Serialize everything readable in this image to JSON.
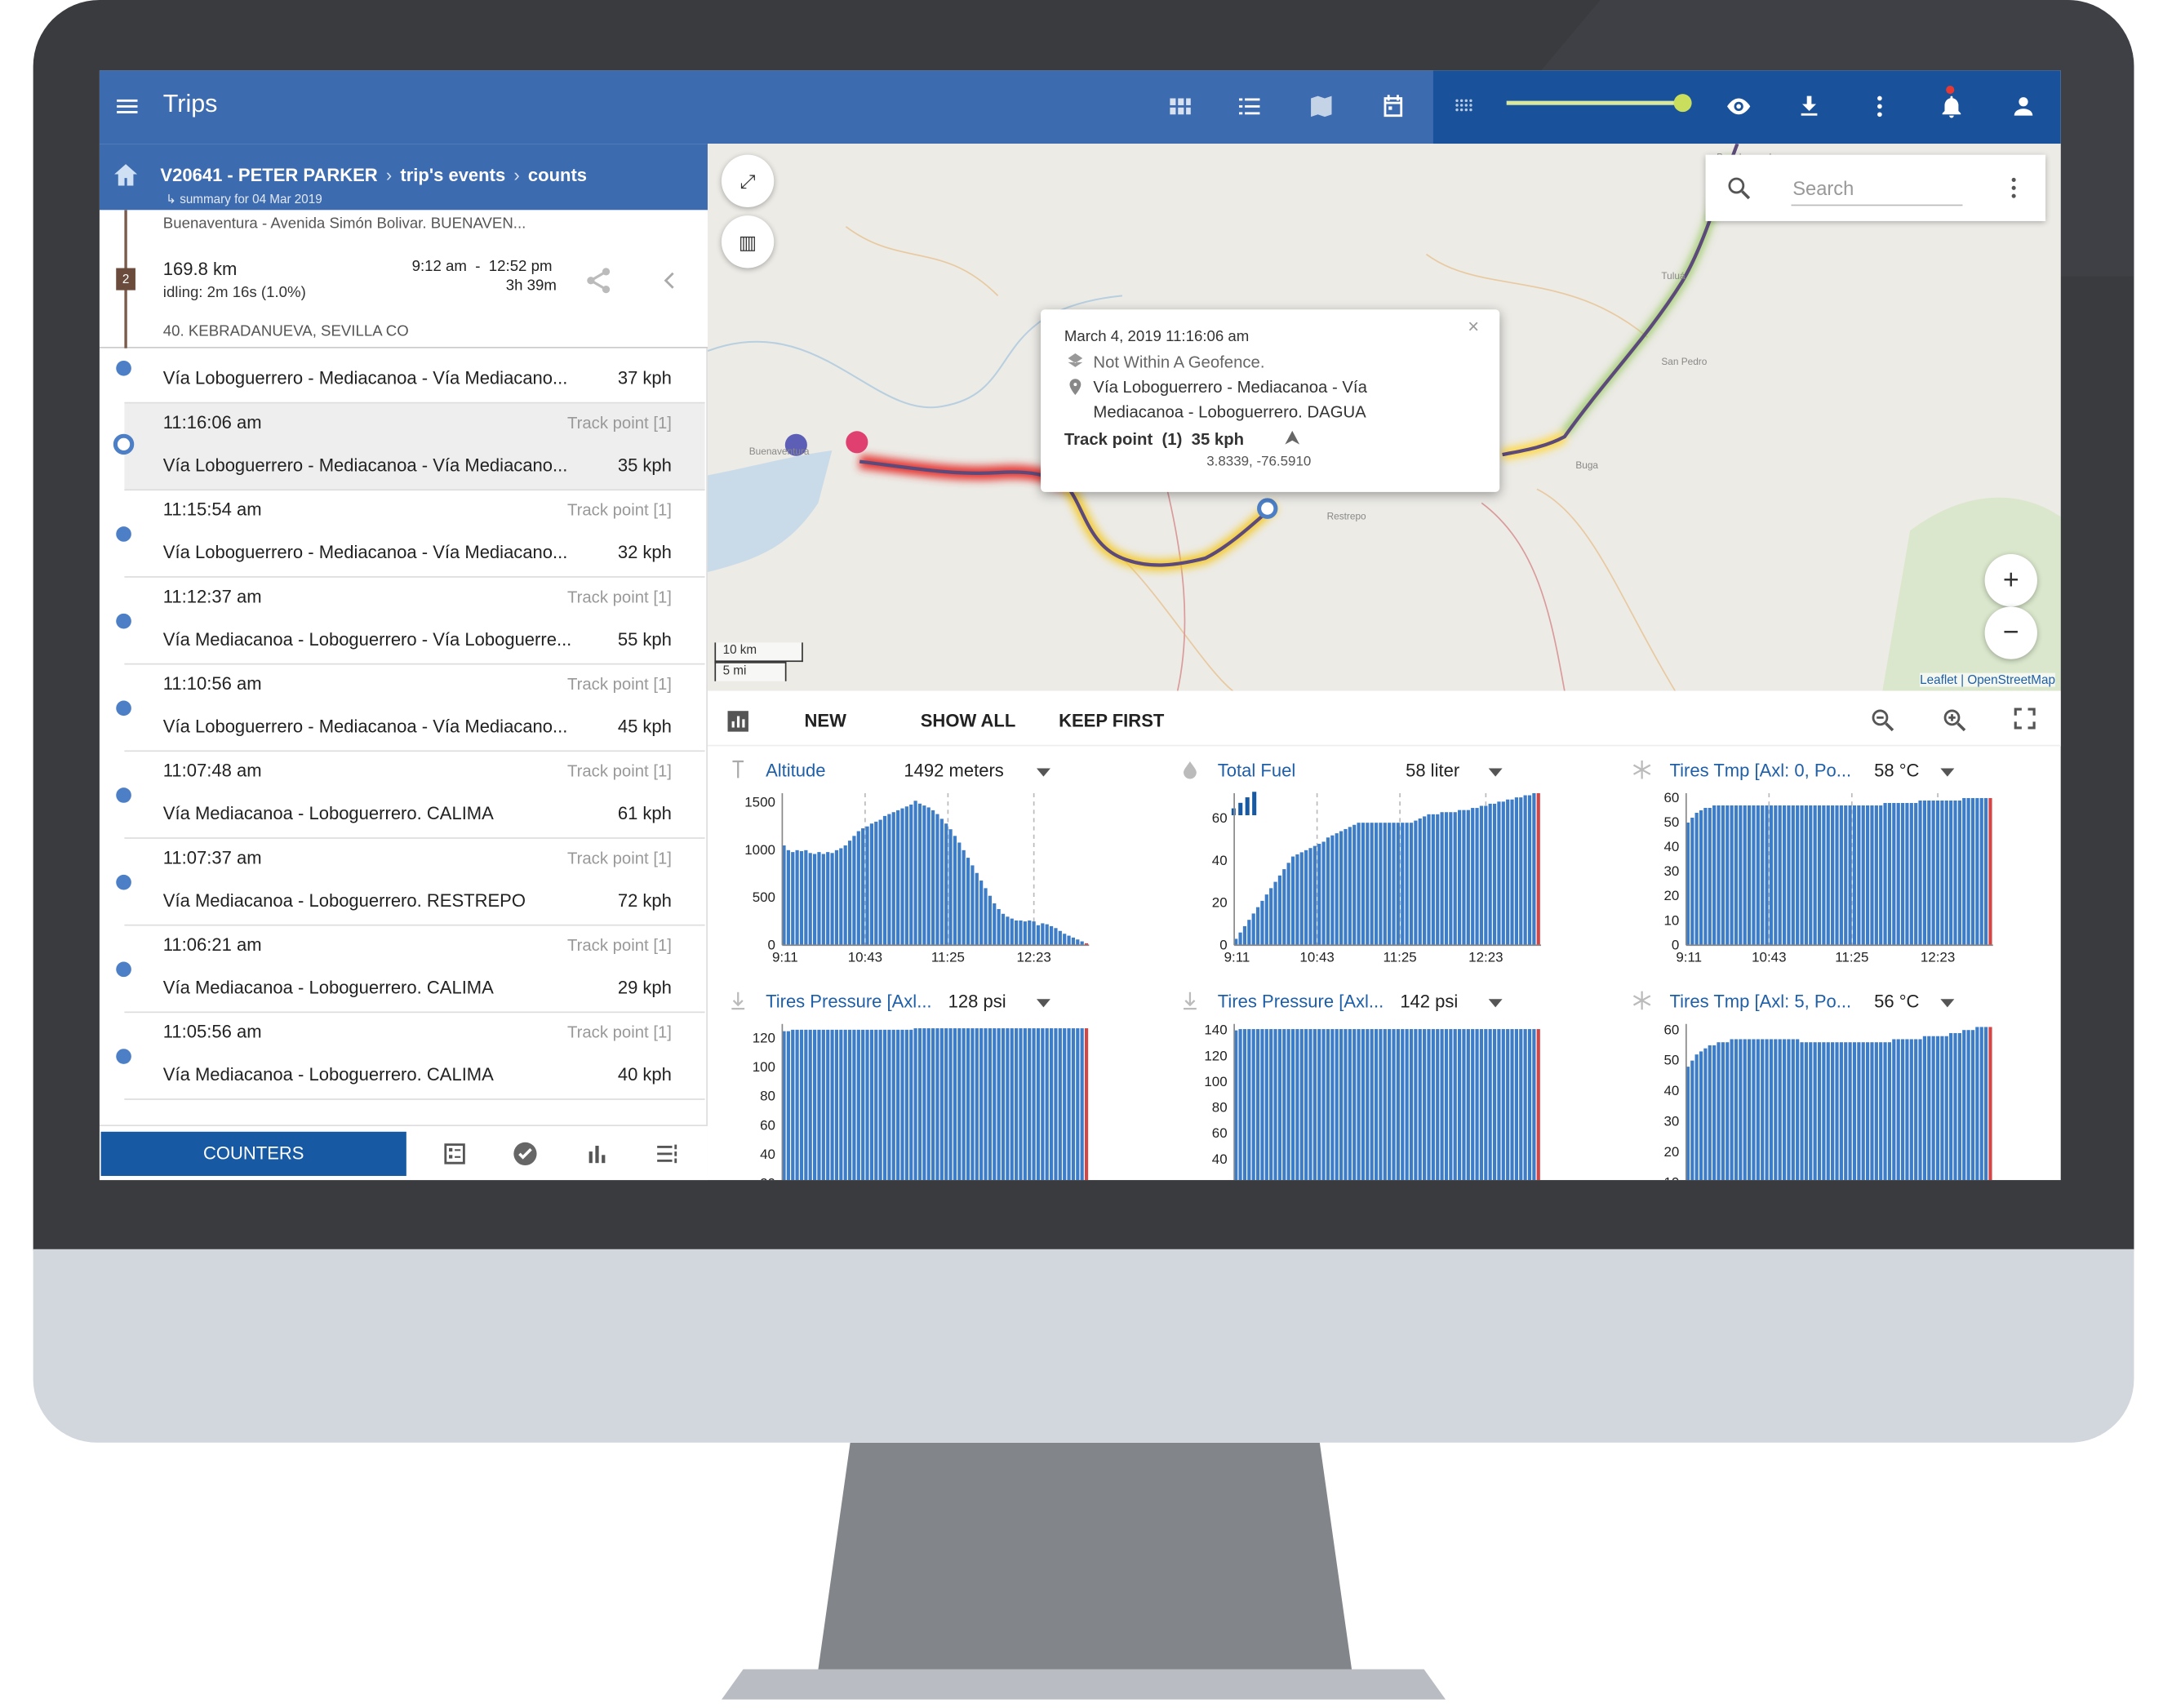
{
  "app": {
    "title": "Trips",
    "colors": {
      "appbar": "#3d6bb0",
      "appbar_dark": "#19519a",
      "accent": "#175aa3",
      "track": "#4c7fc6"
    },
    "toolbar_icons": [
      "grid-view-icon",
      "list-view-icon",
      "map-view-icon",
      "calendar-icon",
      "density-icon",
      "eye-icon",
      "download-icon",
      "more-vert-icon",
      "bell-icon",
      "account-icon"
    ]
  },
  "breadcrumb": {
    "vehicle": "V20641 - PETER PARKER",
    "events": "trip's events",
    "counts": "counts",
    "sub": "↳ summary for 04 Mar 2019"
  },
  "summary": {
    "from": "Buenaventura - Avenida Simón Bolivar. BUENAVEN...",
    "distance": "169.8 km",
    "idling": "idling: 2m 16s (1.0%)",
    "time_range": "9:12 am  -  12:52 pm",
    "duration": "3h 39m",
    "to": "40. KEBRADANUEVA, SEVILLA CO",
    "badge": "2"
  },
  "events": [
    {
      "time": "",
      "kind": "",
      "addr": "Vía Loboguerrero - Mediacanoa - Vía Mediacano...",
      "speed": "37 kph"
    },
    {
      "time": "11:16:06 am",
      "kind": "Track point [1]",
      "addr": "Vía Loboguerrero - Mediacanoa - Vía Mediacano...",
      "speed": "35 kph"
    },
    {
      "time": "11:15:54 am",
      "kind": "Track point [1]",
      "addr": "Vía Loboguerrero - Mediacanoa - Vía Mediacano...",
      "speed": "32 kph"
    },
    {
      "time": "11:12:37 am",
      "kind": "Track point [1]",
      "addr": "Vía Mediacanoa - Loboguerrero - Vía Loboguerre...",
      "speed": "55 kph"
    },
    {
      "time": "11:10:56 am",
      "kind": "Track point [1]",
      "addr": "Vía Loboguerrero - Mediacanoa - Vía Mediacano...",
      "speed": "45 kph"
    },
    {
      "time": "11:07:48 am",
      "kind": "Track point [1]",
      "addr": "Vía Mediacanoa - Loboguerrero. CALIMA",
      "speed": "61 kph"
    },
    {
      "time": "11:07:37 am",
      "kind": "Track point [1]",
      "addr": "Vía Mediacanoa - Loboguerrero. RESTREPO",
      "speed": "72 kph"
    },
    {
      "time": "11:06:21 am",
      "kind": "Track point [1]",
      "addr": "Vía Mediacanoa - Loboguerrero. CALIMA",
      "speed": "29 kph"
    },
    {
      "time": "11:05:56 am",
      "kind": "Track point [1]",
      "addr": "Vía Mediacanoa - Loboguerrero. CALIMA",
      "speed": "40 kph"
    }
  ],
  "bottom": {
    "counters_label": "COUNTERS"
  },
  "map": {
    "search_placeholder": "Search",
    "scale_km": "10 km",
    "scale_mi": "5 mi",
    "attribution": "Leaflet | OpenStreetMap",
    "zoom_in": "+",
    "zoom_out": "−",
    "popup": {
      "datetime": "March 4, 2019 11:16:06 am",
      "geofence": "Not Within A Geofence.",
      "address_1": "Vía Loboguerrero - Mediacanoa - Vía",
      "address_2": "Mediacanoa - Loboguerrero. DAGUA",
      "point": "Track point  (1)  35 kph",
      "coords": "3.8339, -76.5910"
    }
  },
  "chart_toolbar": {
    "new": "NEW",
    "show_all": "SHOW ALL",
    "keep_first": "KEEP FIRST"
  },
  "chart_data": [
    {
      "type": "bar",
      "title": "Altitude",
      "value": "1492 meters",
      "icon": "altitude-icon",
      "x_ticks": [
        "9:11",
        "10:43",
        "11:25",
        "12:23"
      ],
      "ylim": [
        0,
        1600
      ],
      "y_ticks": [
        0,
        500,
        1000,
        1500
      ],
      "values": [
        1050,
        1000,
        980,
        1000,
        990,
        1000,
        970,
        960,
        980,
        960,
        980,
        970,
        1000,
        1020,
        1050,
        1100,
        1150,
        1200,
        1230,
        1250,
        1280,
        1300,
        1320,
        1360,
        1380,
        1400,
        1420,
        1440,
        1460,
        1480,
        1520,
        1490,
        1470,
        1450,
        1420,
        1380,
        1330,
        1280,
        1220,
        1150,
        1080,
        1000,
        920,
        840,
        760,
        680,
        600,
        520,
        440,
        380,
        330,
        300,
        280,
        260,
        260,
        250,
        260,
        250,
        210,
        230,
        220,
        200,
        180,
        150,
        120,
        100,
        80,
        60,
        40,
        20
      ]
    },
    {
      "type": "bar",
      "title": "Total Fuel",
      "value": "58 liter",
      "icon": "fuel-icon",
      "x_ticks": [
        "9:11",
        "10:43",
        "11:25",
        "12:23"
      ],
      "ylim": [
        0,
        72
      ],
      "y_ticks": [
        0,
        20,
        40,
        60
      ],
      "values": [
        3,
        6,
        9,
        12,
        15,
        18,
        21,
        24,
        27,
        30,
        33,
        36,
        39,
        42,
        43,
        44,
        45,
        46,
        47,
        48,
        49,
        51,
        52,
        53,
        54,
        55,
        56,
        57,
        58,
        58,
        58,
        58,
        58,
        58,
        58,
        58,
        58,
        58,
        58,
        58,
        58,
        59,
        60,
        61,
        62,
        62,
        62,
        63,
        63,
        63,
        63,
        64,
        64,
        64,
        65,
        65,
        66,
        66,
        67,
        67,
        68,
        68,
        69,
        69,
        70,
        70,
        71,
        71,
        72,
        72
      ]
    },
    {
      "type": "bar",
      "title": "Tires Tmp [Axl: 0, Po...",
      "value": "58 °C",
      "icon": "snowflake-icon",
      "x_ticks": [
        "9:11",
        "10:43",
        "11:25",
        "12:23"
      ],
      "ylim": [
        0,
        62
      ],
      "y_ticks": [
        0,
        10,
        20,
        30,
        40,
        50,
        60
      ],
      "values": [
        50,
        52,
        54,
        55,
        56,
        56,
        57,
        57,
        57,
        57,
        57,
        57,
        57,
        57,
        57,
        57,
        57,
        57,
        57,
        57,
        57,
        57,
        57,
        57,
        57,
        57,
        57,
        57,
        57,
        57,
        57,
        57,
        57,
        57,
        57,
        57,
        57,
        57,
        57,
        57,
        57,
        57,
        57,
        57,
        57,
        58,
        58,
        58,
        58,
        58,
        58,
        58,
        58,
        59,
        59,
        59,
        59,
        59,
        59,
        59,
        59,
        59,
        59,
        60,
        60,
        60,
        60,
        60,
        60,
        60
      ]
    },
    {
      "type": "bar",
      "title": "Tires Pressure [Axl...",
      "value": "128 psi",
      "icon": "pressure-icon",
      "x_ticks": [],
      "ylim": [
        10,
        130
      ],
      "y_ticks": [
        20,
        40,
        60,
        80,
        100,
        120
      ],
      "values": [
        125,
        125,
        126,
        126,
        126,
        126,
        126,
        126,
        126,
        126,
        126,
        126,
        126,
        126,
        126,
        126,
        126,
        126,
        126,
        126,
        126,
        126,
        126,
        126,
        126,
        126,
        126,
        126,
        126,
        126,
        127,
        127,
        127,
        127,
        127,
        127,
        127,
        127,
        127,
        127,
        127,
        127,
        127,
        127,
        127,
        127,
        127,
        127,
        127,
        127,
        127,
        127,
        127,
        127,
        127,
        127,
        127,
        127,
        127,
        127,
        127,
        127,
        127,
        127,
        127,
        127,
        127,
        127,
        127,
        127
      ]
    },
    {
      "type": "bar",
      "title": "Tires Pressure [Axl...",
      "value": "142 psi",
      "icon": "pressure-icon",
      "x_ticks": [],
      "ylim": [
        10,
        145
      ],
      "y_ticks": [
        20,
        40,
        60,
        80,
        100,
        120,
        140
      ],
      "values": [
        140,
        141,
        141,
        141,
        141,
        141,
        141,
        141,
        141,
        141,
        141,
        141,
        141,
        141,
        141,
        141,
        141,
        141,
        141,
        141,
        141,
        141,
        141,
        141,
        141,
        141,
        141,
        141,
        141,
        141,
        141,
        141,
        141,
        141,
        141,
        141,
        141,
        141,
        141,
        141,
        141,
        141,
        141,
        141,
        141,
        141,
        141,
        141,
        141,
        141,
        141,
        141,
        141,
        141,
        141,
        141,
        141,
        141,
        141,
        141,
        141,
        141,
        141,
        141,
        141,
        141,
        141,
        141,
        141,
        141
      ]
    },
    {
      "type": "bar",
      "title": "Tires Tmp [Axl: 5, Po...",
      "value": "56 °C",
      "icon": "snowflake-icon",
      "x_ticks": [],
      "ylim": [
        5,
        62
      ],
      "y_ticks": [
        10,
        20,
        30,
        40,
        50,
        60
      ],
      "values": [
        48,
        50,
        52,
        53,
        54,
        55,
        55,
        56,
        56,
        56,
        57,
        57,
        57,
        57,
        57,
        57,
        57,
        57,
        57,
        57,
        57,
        57,
        57,
        57,
        57,
        57,
        56,
        56,
        56,
        56,
        56,
        56,
        56,
        56,
        56,
        56,
        56,
        56,
        56,
        56,
        56,
        56,
        56,
        56,
        56,
        56,
        56,
        57,
        57,
        57,
        57,
        57,
        57,
        57,
        58,
        58,
        58,
        58,
        58,
        58,
        59,
        59,
        59,
        60,
        60,
        60,
        61,
        61,
        61,
        61
      ]
    }
  ]
}
